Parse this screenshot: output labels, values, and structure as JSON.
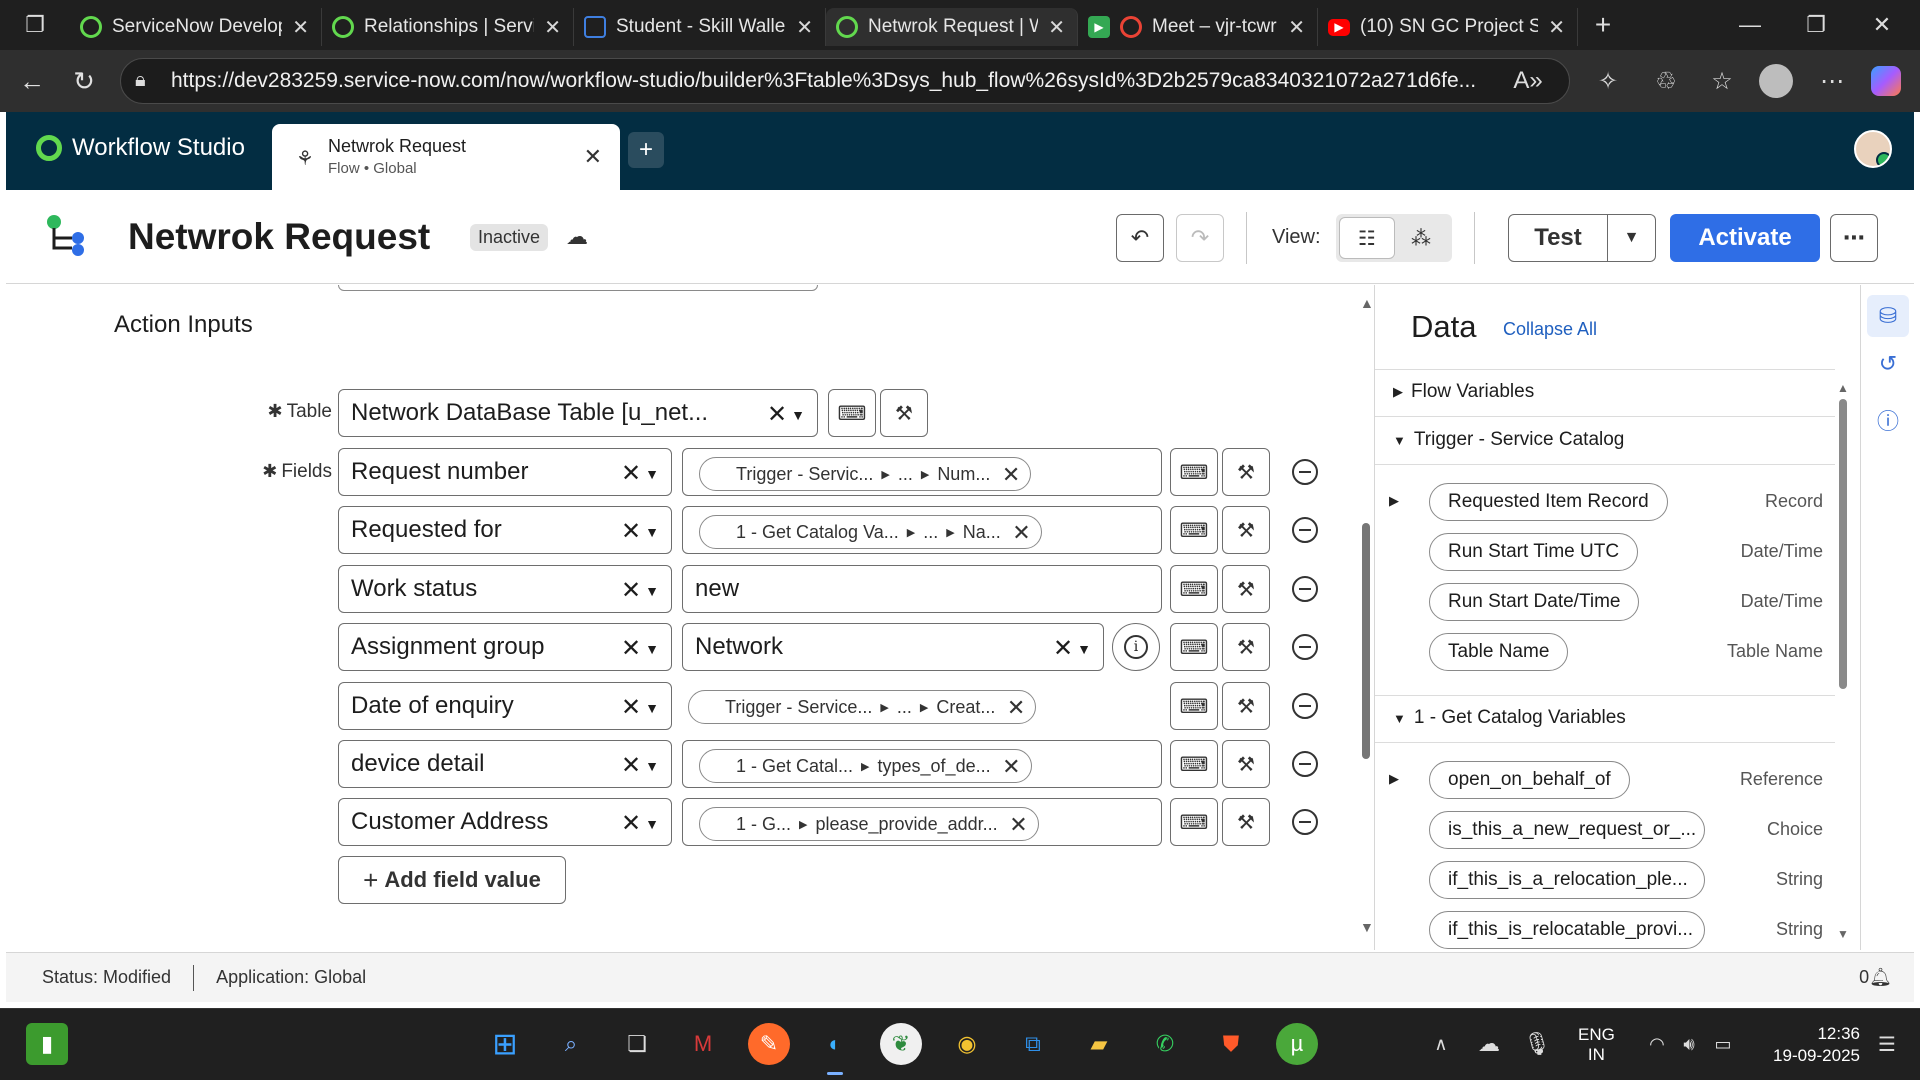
{
  "browser": {
    "tabs": [
      {
        "title": "ServiceNow Develop",
        "color": "#62d84e",
        "icon": "servicenow-icon"
      },
      {
        "title": "Relationships | Servic",
        "color": "#62d84e",
        "icon": "servicenow-icon"
      },
      {
        "title": "Student - Skill Walle",
        "color": "#3f7fe0",
        "icon": "skillwallet-icon"
      },
      {
        "title": "Netwrok Request | W",
        "color": "#62d84e",
        "icon": "servicenow-icon",
        "active": true
      },
      {
        "title": "Meet – vjr-tcwr",
        "color": "#ea4335",
        "icon": "meet-icon"
      },
      {
        "title": "(10) SN GC Project S",
        "color": "#ff0000",
        "icon": "youtube-icon"
      }
    ],
    "url": "https://dev283259.service-now.com/now/workflow-studio/builder%3Ftable%3Dsys_hub_flow%26sysId%3D2b2579ca8340321072a271d6fe..."
  },
  "app": {
    "name": "Workflow Studio",
    "tab": {
      "title": "Netwrok Request",
      "subtitle": "Flow • Global"
    },
    "accent": "#62d84e",
    "header_bg": "#032d42"
  },
  "flow": {
    "name": "Netwrok Request",
    "status_badge": "Inactive",
    "view_label": "View:",
    "test_label": "Test",
    "activate_label": "Activate",
    "activate_color": "#2f6ee6"
  },
  "editor": {
    "section_title": "Action Inputs",
    "table_label": "Table",
    "fields_label": "Fields",
    "table_value": "Network DataBase Table [u_net...",
    "fields": [
      {
        "name": "Request number",
        "value_type": "pill",
        "pill": [
          "Trigger - Servic...",
          "...",
          "Num..."
        ]
      },
      {
        "name": "Requested for",
        "value_type": "pill",
        "pill": [
          "1 - Get Catalog Va...",
          "...",
          "Na..."
        ]
      },
      {
        "name": "Work status",
        "value_type": "text",
        "text": "new"
      },
      {
        "name": "Assignment group",
        "value_type": "select",
        "text": "Network"
      },
      {
        "name": "Date of enquiry",
        "value_type": "pill",
        "pill": [
          "Trigger - Service...",
          "...",
          "Creat..."
        ]
      },
      {
        "name": "device detail",
        "value_type": "pill",
        "pill": [
          "1 - Get Catal...",
          "types_of_de..."
        ]
      },
      {
        "name": "Customer Address",
        "value_type": "pill",
        "pill": [
          "1 - G...",
          "please_provide_addr..."
        ]
      }
    ],
    "add_field_label": "Add field value"
  },
  "data_panel": {
    "title": "Data",
    "collapse_all": "Collapse All",
    "groups": [
      {
        "label": "Flow Variables",
        "expanded": false
      },
      {
        "label": "Trigger - Service Catalog",
        "expanded": true,
        "items": [
          {
            "name": "Requested Item Record",
            "type": "Record",
            "expandable": true
          },
          {
            "name": "Run Start Time UTC",
            "type": "Date/Time"
          },
          {
            "name": "Run Start Date/Time",
            "type": "Date/Time"
          },
          {
            "name": "Table Name",
            "type": "Table Name"
          }
        ]
      },
      {
        "label": "1 - Get Catalog Variables",
        "expanded": true,
        "items": [
          {
            "name": "open_on_behalf_of",
            "type": "Reference",
            "expandable": true
          },
          {
            "name": "is_this_a_new_request_or_...",
            "type": "Choice"
          },
          {
            "name": "if_this_is_a_relocation_ple...",
            "type": "String"
          },
          {
            "name": "if_this_is_relocatable_provi...",
            "type": "String"
          }
        ]
      }
    ]
  },
  "status": {
    "status_text": "Status: Modified",
    "application_text": "Application: Global",
    "notifications": "0"
  },
  "taskbar": {
    "language": "ENG",
    "region": "IN",
    "time": "12:36",
    "date": "19-09-2025"
  }
}
